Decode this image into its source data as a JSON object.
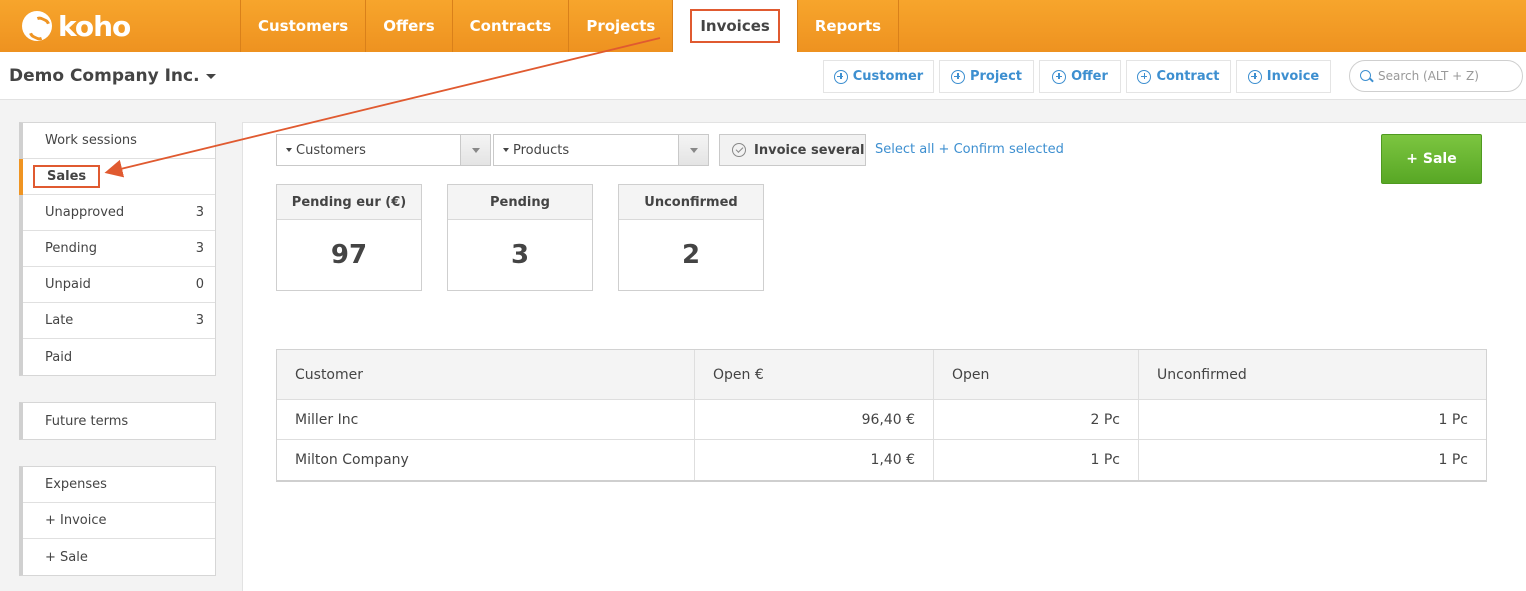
{
  "app": {
    "logo_text": "koho"
  },
  "nav": {
    "tabs": [
      {
        "label": "Customers"
      },
      {
        "label": "Offers"
      },
      {
        "label": "Contracts"
      },
      {
        "label": "Projects"
      },
      {
        "label": "Invoices",
        "active": true
      },
      {
        "label": "Reports"
      }
    ]
  },
  "header": {
    "company": "Demo Company Inc.",
    "quick_actions": [
      "Customer",
      "Project",
      "Offer",
      "Contract",
      "Invoice"
    ],
    "search_placeholder": "Search (ALT + Z)"
  },
  "sidebar": {
    "group1": [
      {
        "label": "Work sessions",
        "count": ""
      },
      {
        "label": "Sales",
        "count": "",
        "active": true
      },
      {
        "label": "Unapproved",
        "count": "3"
      },
      {
        "label": "Pending",
        "count": "3"
      },
      {
        "label": "Unpaid",
        "count": "0"
      },
      {
        "label": "Late",
        "count": "3"
      },
      {
        "label": "Paid",
        "count": ""
      }
    ],
    "group2": [
      {
        "label": "Future terms"
      }
    ],
    "group3": [
      {
        "label": "Expenses"
      },
      {
        "label": "+ Invoice"
      },
      {
        "label": "+ Sale"
      }
    ]
  },
  "filters": {
    "customers": "Customers",
    "products": "Products",
    "invoice_several": "Invoice several",
    "select_link": "Select all + Confirm selected"
  },
  "sale_button": "+ Sale",
  "cards": [
    {
      "title": "Pending eur (€)",
      "value": "97"
    },
    {
      "title": "Pending",
      "value": "3"
    },
    {
      "title": "Unconfirmed",
      "value": "2"
    }
  ],
  "table": {
    "headers": [
      "Customer",
      "Open €",
      "Open",
      "Unconfirmed"
    ],
    "rows": [
      [
        "Miller Inc",
        "96,40 €",
        "2 Pc",
        "1 Pc"
      ],
      [
        "Milton Company",
        "1,40 €",
        "1 Pc",
        "1 Pc"
      ]
    ]
  },
  "colors": {
    "brand_orange": "#ef9422",
    "link_blue": "#3d8fd0",
    "sale_green": "#6ab833",
    "annotation_red": "#e05a30"
  }
}
